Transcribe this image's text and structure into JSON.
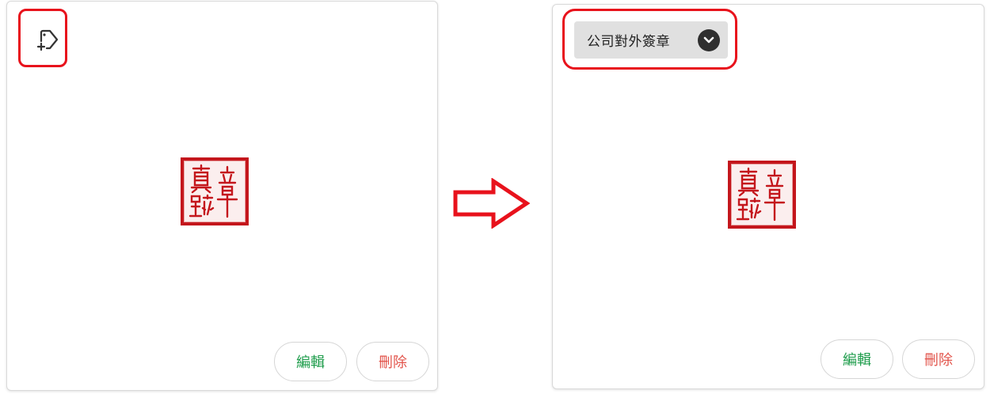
{
  "before_card": {
    "tag_add_icon": "tag-plus-icon",
    "seal_image": "red-seal-stamp",
    "edit_label": "編輯",
    "delete_label": "刪除"
  },
  "after_card": {
    "tag_label": "公司對外簽章",
    "tag_dropdown_icon": "chevron-down-circle-icon",
    "seal_image": "red-seal-stamp",
    "edit_label": "編輯",
    "delete_label": "刪除"
  },
  "transition_arrow": "right-arrow-icon",
  "colors": {
    "highlight": "#e8121c",
    "seal_red": "#c4161c",
    "edit_green": "#1f9d4c",
    "delete_red": "#e2544b",
    "chip_bg": "#e0e0e0"
  }
}
